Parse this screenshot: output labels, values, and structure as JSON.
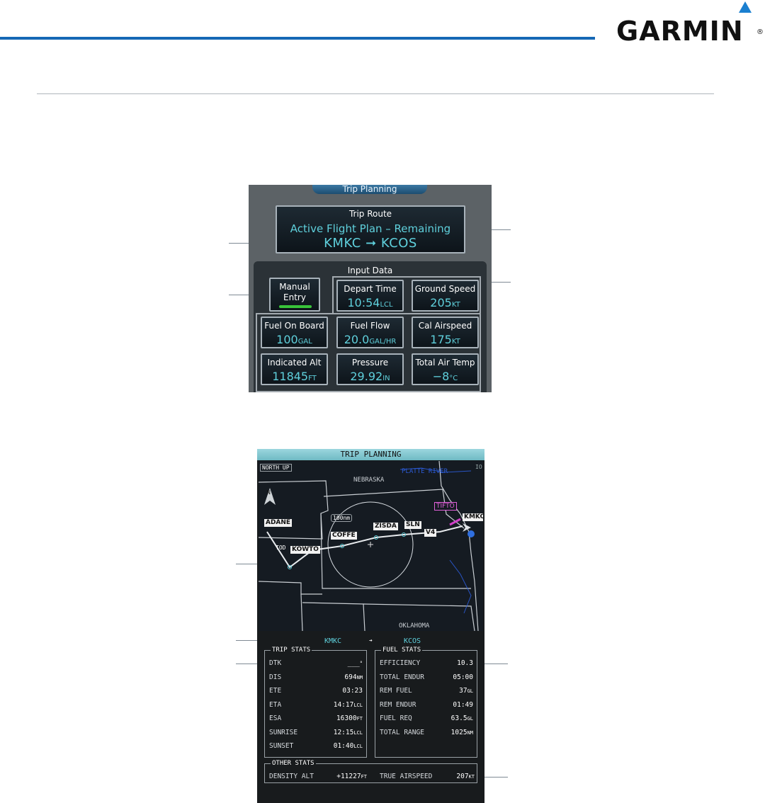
{
  "brand": {
    "logo_text": "GARMIN",
    "registered": "®",
    "accent": "#1668b5"
  },
  "trip_planning_panel": {
    "tab_title": "Trip Planning",
    "trip_route": {
      "title": "Trip Route",
      "mode": "Active Flight Plan – Remaining",
      "route": "KMKC ➞ KCOS"
    },
    "input_data": {
      "title": "Input Data",
      "manual_entry": {
        "line1": "Manual",
        "line2": "Entry",
        "indicator_color": "#39c43a"
      },
      "keys": [
        {
          "label": "Depart Time",
          "value": "10:54",
          "unit": "LCL"
        },
        {
          "label": "Ground Speed",
          "value": "205",
          "unit": "KT"
        },
        {
          "label": "Fuel On Board",
          "value": "100",
          "unit": "GAL"
        },
        {
          "label": "Fuel Flow",
          "value": "20.0",
          "unit": "GAL/HR"
        },
        {
          "label": "Cal Airspeed",
          "value": "175",
          "unit": "KT"
        },
        {
          "label": "Indicated Alt",
          "value": "11845",
          "unit": "FT"
        },
        {
          "label": "Pressure",
          "value": "29.92",
          "unit": "IN"
        },
        {
          "label": "Total Air Temp",
          "value": "−8",
          "unit": "°C"
        }
      ]
    }
  },
  "mfd_panel": {
    "title": "TRIP PLANNING",
    "map": {
      "orientation": "NORTH UP",
      "north_label": "N",
      "labels": {
        "state_top": "NEBRASKA",
        "state_bottom": "OKLAHOMA",
        "river": "PLATTE RIVER",
        "range": "100nm",
        "corner": "IO"
      },
      "waypoints": {
        "adane": "ADANE",
        "tod": "TOD",
        "kowto": "KOWTO",
        "coffe": "COFFE",
        "zisda": "ZISDA",
        "sln": "SLN",
        "v4": "V4",
        "tifto": "TIFTO",
        "kmkc": "KMKC"
      }
    },
    "route": {
      "from": "KMKC",
      "arrow": "➔",
      "to": "KCOS"
    },
    "trip_stats": {
      "title": "TRIP STATS",
      "rows": [
        {
          "label": "DTK",
          "value": "___",
          "unit": "°"
        },
        {
          "label": "DIS",
          "value": "694",
          "unit": "NM"
        },
        {
          "label": "ETE",
          "value": "03:23",
          "unit": ""
        },
        {
          "label": "ETA",
          "value": "14:17",
          "unit": "LCL"
        },
        {
          "label": "ESA",
          "value": "16300",
          "unit": "FT"
        },
        {
          "label": "SUNRISE",
          "value": "12:15",
          "unit": "LCL"
        },
        {
          "label": "SUNSET",
          "value": "01:40",
          "unit": "LCL"
        }
      ]
    },
    "fuel_stats": {
      "title": "FUEL STATS",
      "rows": [
        {
          "label": "EFFICIENCY",
          "value": "10.3",
          "unit": ""
        },
        {
          "label": "TOTAL ENDUR",
          "value": "05:00",
          "unit": ""
        },
        {
          "label": "REM FUEL",
          "value": "37",
          "unit": "GL"
        },
        {
          "label": "REM ENDUR",
          "value": "01:49",
          "unit": ""
        },
        {
          "label": "FUEL REQ",
          "value": "63.5",
          "unit": "GL"
        },
        {
          "label": "TOTAL RANGE",
          "value": "1025",
          "unit": "NM"
        }
      ]
    },
    "other_stats": {
      "title": "OTHER STATS",
      "density_alt_label": "DENSITY ALT",
      "density_alt_value": "+11227",
      "density_alt_unit": "FT",
      "true_airspeed_label": "TRUE AIRSPEED",
      "true_airspeed_value": "207",
      "true_airspeed_unit": "KT"
    }
  }
}
